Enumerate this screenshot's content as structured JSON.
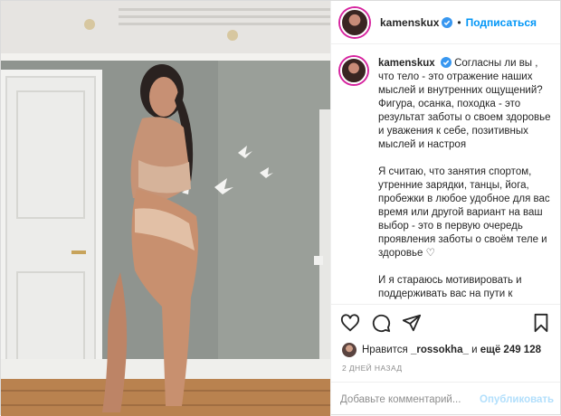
{
  "post": {
    "image_alt": "woman in beige lingerie standing in a room with white door and decorative birds on wall"
  },
  "header": {
    "username": "kamenskux",
    "dot": "•",
    "follow_label": "Подписаться",
    "more_label": "•••"
  },
  "caption": {
    "username": "kamenskux",
    "paragraphs": [
      "Согласны ли вы , что тело - это отражение наших мыслей и внутренних ощущений? Фигура, осанка, походка - это результат заботы о своем здоровье и уважения к себе, позитивных мыслей и настроя",
      "Я считаю, что занятия спортом, утренние зарядки, танцы, йога, пробежки в любое удобное для вас время или другой вариант на ваш выбор - это в первую очередь проявления заботы о своём теле и здоровье ♡",
      "И я стараюсь мотивировать и поддерживать вас на пути к вашему здоровому и спортивному телу 🥰"
    ]
  },
  "likes": {
    "prefix": "Нравится",
    "user": "_rossokha_",
    "middle": "и",
    "count": "ещё 249 128"
  },
  "time_label": "2 дней назад",
  "comment_box": {
    "placeholder": "Добавьте комментарий...",
    "publish_label": "Опубликовать"
  },
  "icons": [
    "heart-icon",
    "comment-icon",
    "share-icon",
    "bookmark-icon",
    "verified-badge-icon",
    "more-icon"
  ],
  "colors": {
    "accent": "#0095f6",
    "publish_disabled": "#b2dffc",
    "muted": "#8e8e8e"
  }
}
